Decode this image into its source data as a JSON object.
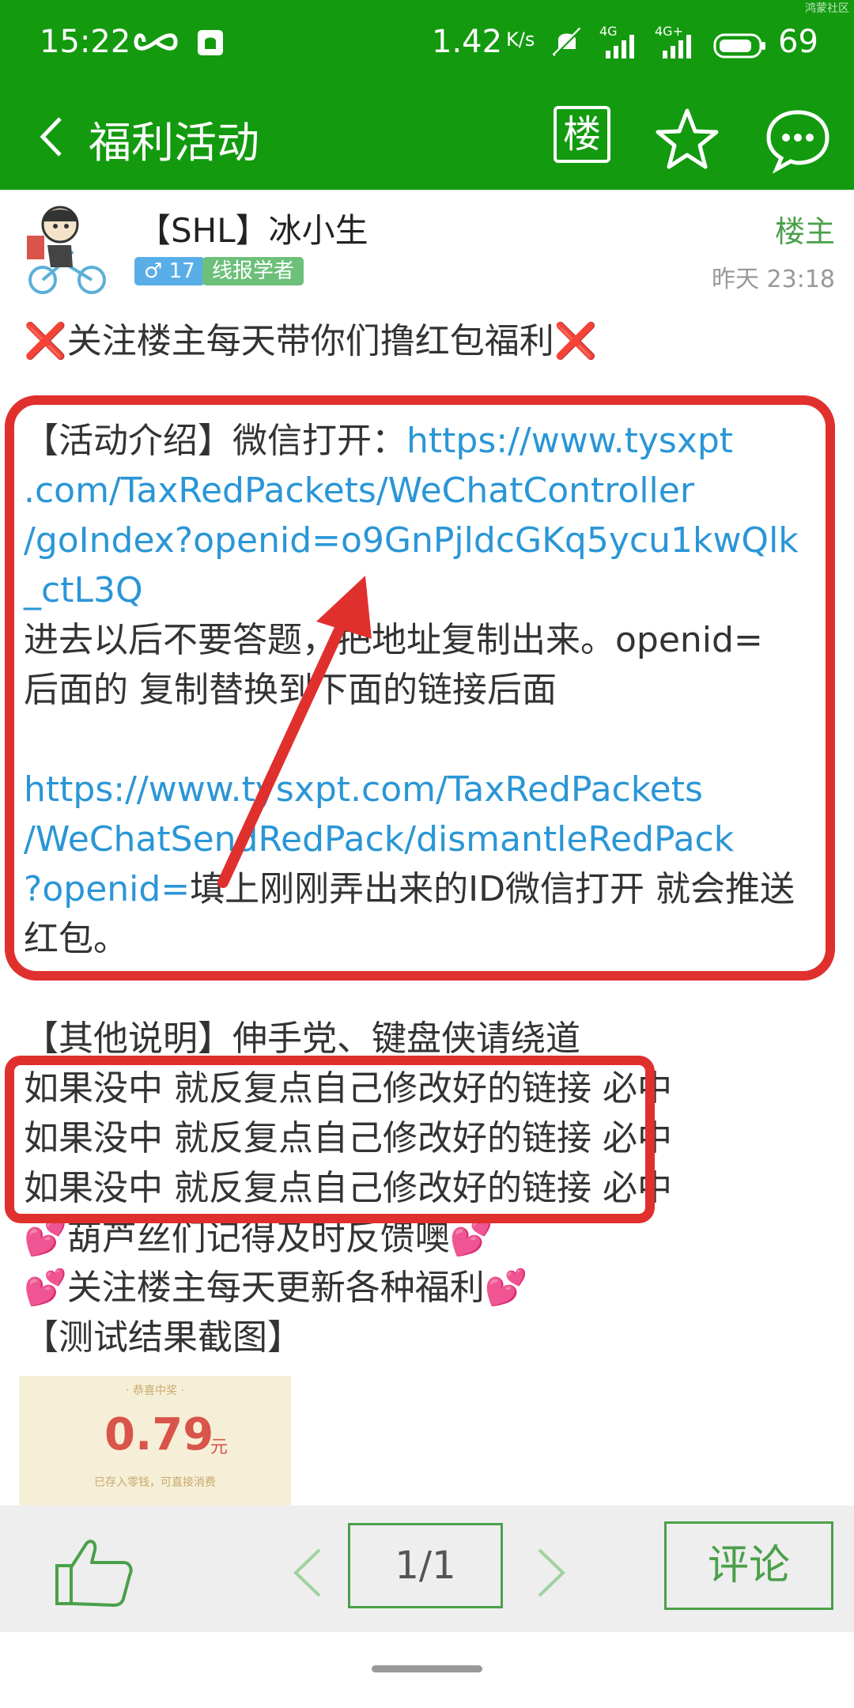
{
  "status": {
    "time": "15:22",
    "speed": "1.42",
    "speed_unit": "K/s",
    "net1": "4G",
    "net2": "4G+",
    "battery": "69",
    "watermark": "鸿蒙社区"
  },
  "nav": {
    "title": "福利活动",
    "floor_btn": "楼"
  },
  "post": {
    "author": "【SHL】冰小生",
    "gender_level": "♂ 17",
    "user_title": "线报学者",
    "op_label": "楼主",
    "time": "昨天 23:18"
  },
  "content": {
    "line1_a": "❌",
    "line1_b": "关注楼主每天带你们撸红包福利",
    "line1_c": "❌",
    "intro_prefix": "【活动介绍】微信打开：",
    "link1_a": "https://www.tysxpt",
    "link1_b": ".com/TaxRedPackets/WeChatController",
    "link1_c": "/goIndex?openid=o9GnPjldcGKq5ycu1kwQlk",
    "link1_d": "_ctL3Q",
    "text2": "进去以后不要答题，把地址复制出来。openid=",
    "text3": "后面的 复制替换到下面的链接后面",
    "link2_a": "https://www.tysxpt.com/TaxRedPackets",
    "link2_b": "/WeChatSendRedPack/dismantleRedPack",
    "link2_c": "?openid=",
    "text4": "填上刚刚弄出来的ID微信打开 就会推送",
    "text5": "红包。",
    "other": "【其他说明】伸手党、键盘侠请绕道",
    "repeat1": "如果没中 就反复点自己修改好的链接 必中",
    "repeat2": "如果没中 就反复点自己修改好的链接 必中",
    "repeat3": "如果没中 就反复点自己修改好的链接 必中",
    "heart": "💕",
    "feedback": "葫芦丝们记得及时反馈噢",
    "follow": "关注楼主每天更新各种福利",
    "screenshot_label": "【测试结果截图】"
  },
  "thumbnail": {
    "label": "· 恭喜中奖 ·",
    "amount": "0.79",
    "unit": "元",
    "sub": "已存入零钱，可直接消费"
  },
  "bottom": {
    "page": "1/1",
    "comment": "评论"
  },
  "colors": {
    "brand_green": "#139a0f",
    "link_blue": "#2a96d6",
    "highlight_red": "#e0302e"
  },
  "icons": [
    "infinity-icon",
    "notification-icon",
    "mute-icon",
    "signal-icon",
    "battery-icon",
    "back-icon",
    "star-icon",
    "message-icon",
    "thumbs-up-icon",
    "chevron-left-icon",
    "chevron-right-icon"
  ]
}
